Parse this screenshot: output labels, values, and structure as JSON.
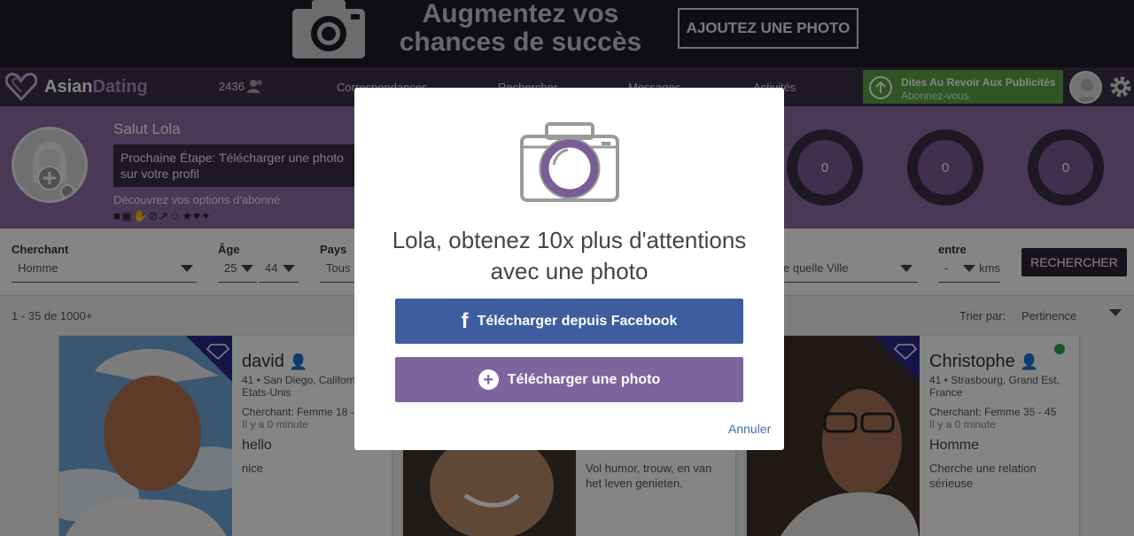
{
  "promo": {
    "headline": "Augmentez vos chances de succès",
    "button": "AJOUTEZ UNE PHOTO"
  },
  "nav": {
    "brand_first": "Asian",
    "brand_second": "Dating",
    "members_count": "2436",
    "links": [
      "Correspondances",
      "Rechercher",
      "Messages",
      "Activités"
    ],
    "upgrade_title": "Dites Au Revoir Aux Publicités",
    "upgrade_sub": "Abonnez-vous"
  },
  "profile": {
    "greeting": "Salut Lola",
    "next_step": "Prochaine Étape: Télécharger une photo sur votre profil",
    "discover": "Découvrez vos options d'abonné",
    "stats": [
      "0",
      "0",
      "0"
    ]
  },
  "filters": {
    "seeking_label": "Cherchant",
    "seeking_value": "Homme",
    "age_label": "Âge",
    "age_min": "25",
    "age_max": "44",
    "country_label": "Pays",
    "country_value": "Tous",
    "city_value": "e quelle Ville",
    "range_label": "entre",
    "range_value": "-",
    "range_unit": "kms",
    "search_button": "RECHERCHER"
  },
  "results": {
    "count": "1 - 35 de 1000+",
    "sort_label": "Trier par:",
    "sort_value": "Pertinence"
  },
  "cards": [
    {
      "name": "david",
      "location": "41 • San Diego, California, Etats-Unis",
      "seeking": "Cherchant: Femme 18 -",
      "ago": "Il y a 0 minute",
      "headline": "hello",
      "desc": "nice"
    },
    {
      "name": "",
      "location": "",
      "seeking": "",
      "ago": "",
      "headline": "",
      "desc": "Vol humor, trouw, en van het leven genieten."
    },
    {
      "name": "Christophe",
      "location": "41 • Strasbourg, Grand Est, France",
      "seeking": "Cherchant: Femme 35 - 45",
      "ago": "Il y a 0 minute",
      "headline": "Homme",
      "desc": "Cherche une relation sérieuse"
    }
  ],
  "modal": {
    "title": "Lola, obtenez 10x plus d'attentions avec une photo",
    "facebook_button": "Télécharger depuis Facebook",
    "upload_button": "Télécharger une photo",
    "cancel": "Annuler"
  },
  "colors": {
    "brand_purple": "#8d6ca6",
    "dark": "#3a3047",
    "facebook": "#3e5d9e",
    "upload": "#7e649c",
    "upgrade_green": "#5ba445"
  }
}
